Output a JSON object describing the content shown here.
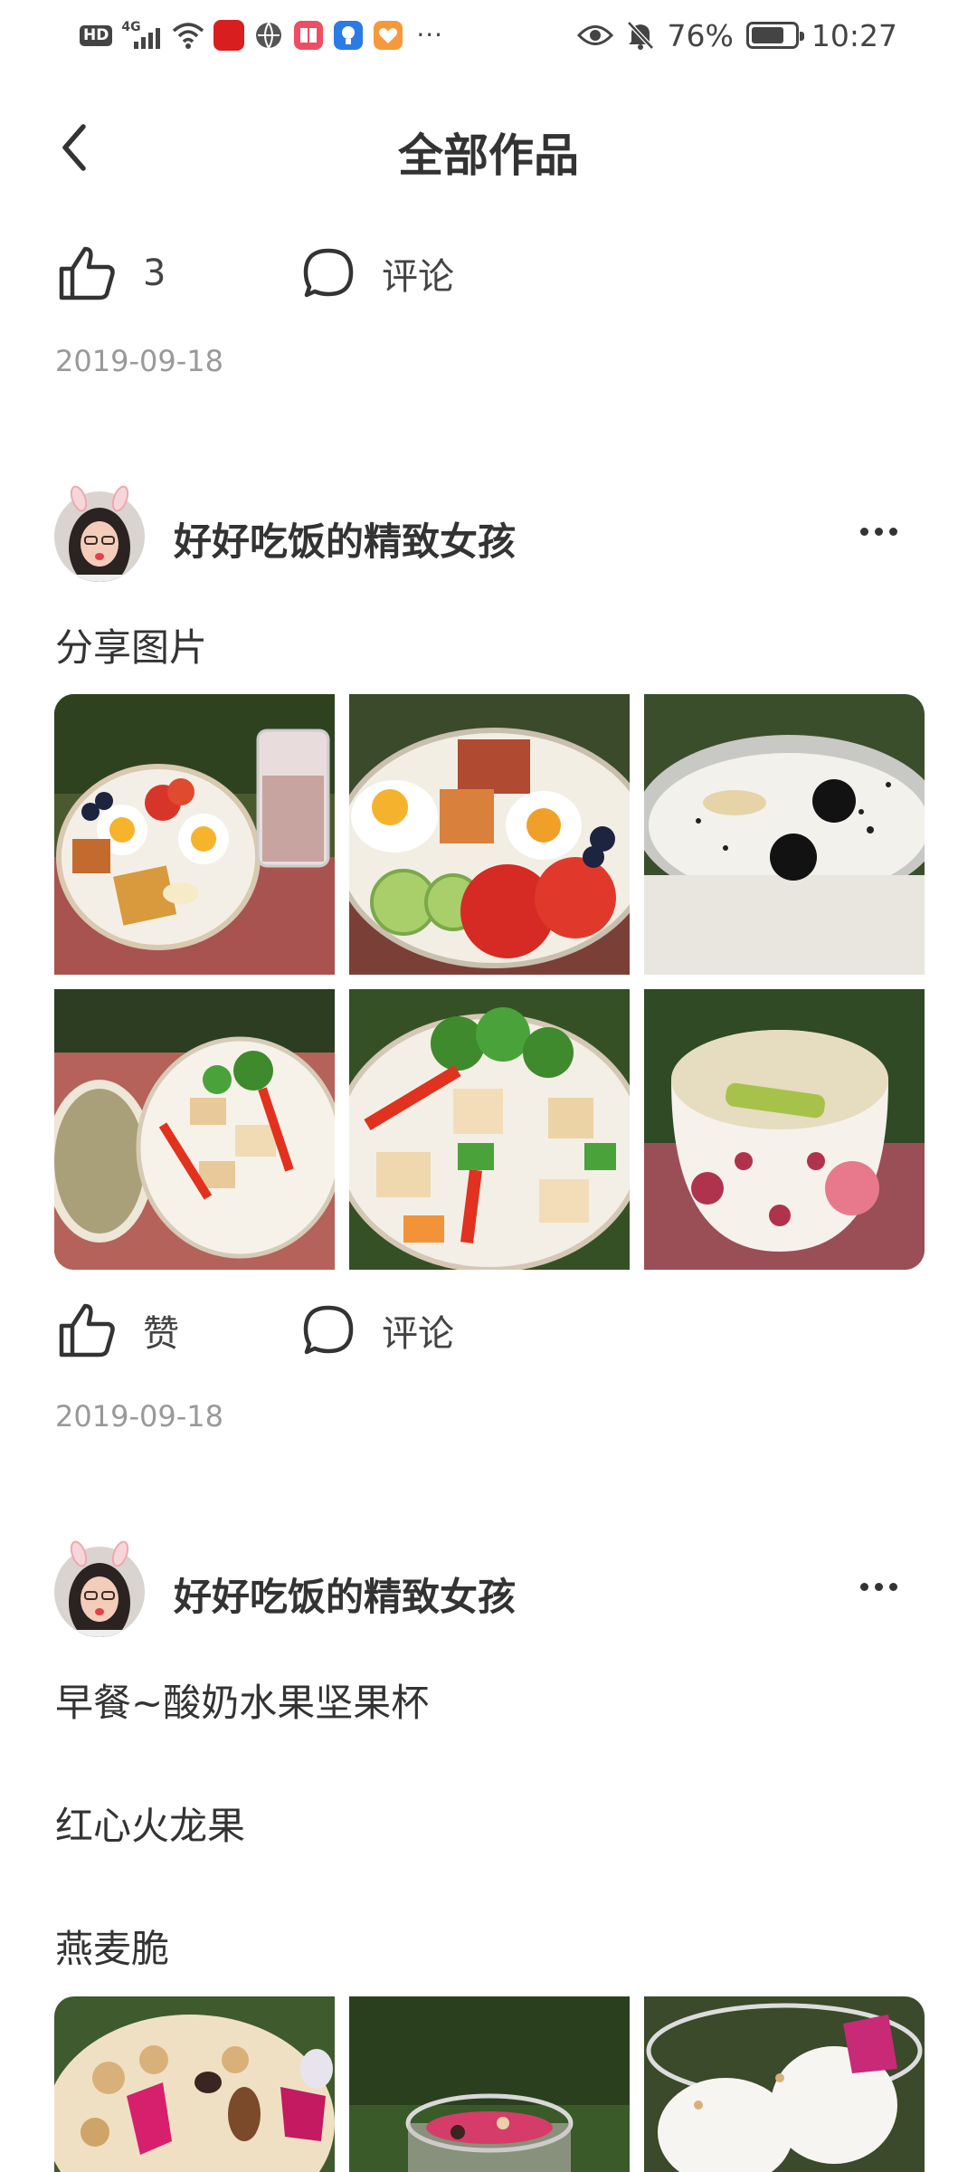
{
  "status_bar": {
    "hd": "HD",
    "network": "4G",
    "dots": "···",
    "battery": "76%",
    "time": "10:27"
  },
  "header": {
    "title": "全部作品",
    "back_icon": "chevron-left-icon"
  },
  "post0": {
    "likes": "3",
    "comment_label": "评论",
    "date": "2019-09-18"
  },
  "post1": {
    "author": "好好吃饭的精致女孩",
    "text": "分享图片",
    "like_label": "赞",
    "comment_label": "评论",
    "date": "2019-09-18",
    "photos": [
      "salad-plate-with-drink",
      "egg-tomato-plate",
      "yogurt-bowl",
      "rice-and-tofu-dishes",
      "tofu-vegetable-stirfry",
      "rice-bowl"
    ]
  },
  "post2": {
    "author": "好好吃饭的精致女孩",
    "line1": "早餐~酸奶水果坚果杯",
    "line2": "红心火龙果",
    "line3": "燕麦脆",
    "photos": [
      "granola-dragonfruit",
      "glass-cup",
      "yogurt-dragonfruit"
    ]
  },
  "colors": {
    "text": "#333333",
    "date": "#999999",
    "background": "#ffffff"
  }
}
